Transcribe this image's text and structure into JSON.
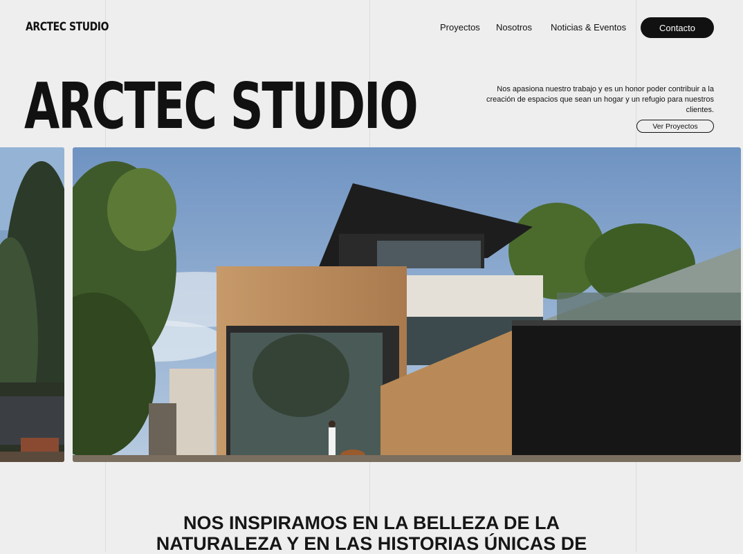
{
  "brand": {
    "logo": "ARCTEC STUDIO"
  },
  "nav": {
    "items": [
      {
        "label": "Proyectos"
      },
      {
        "label": "Nosotros"
      },
      {
        "label": "Noticias & Eventos"
      }
    ],
    "contact_label": "Contacto"
  },
  "hero": {
    "title": "ARCTEC STUDIO",
    "intro": "Nos apasiona nuestro trabajo y es un honor poder contribuir a la creación de espacios que sean un hogar y un refugio para nuestros clientes.",
    "cta_label": "Ver Proyectos"
  },
  "mission": {
    "line1": "NOS INSPIRAMOS EN LA BELLEZA DE LA",
    "line2": "NATURALEZA Y EN LAS HISTORIAS ÚNICAS DE"
  },
  "colors": {
    "background": "#eeeeee",
    "text": "#111111",
    "button": "#111111"
  }
}
